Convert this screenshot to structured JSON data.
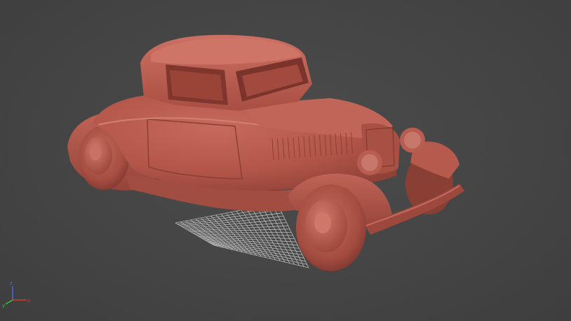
{
  "viewport": {
    "view": "perspective",
    "shading": "clay",
    "model_color": "#b85b50",
    "background_color": "#464646",
    "grid_color": "#d0d0d0",
    "axis_colors": {
      "x": "#d33a2a",
      "y": "#3fbf3f",
      "z": "#4a6be0"
    },
    "icons": [
      "view-axis-gizmo-icon"
    ]
  }
}
